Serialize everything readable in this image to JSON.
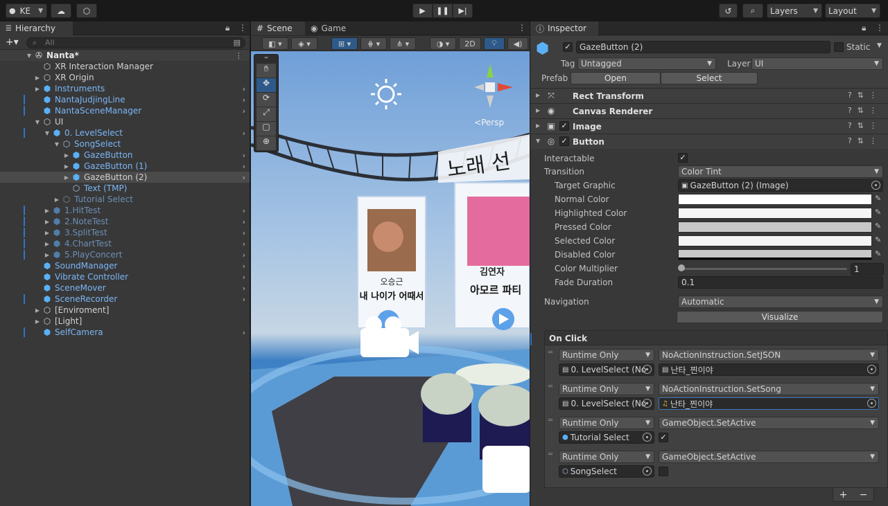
{
  "toolbar": {
    "account": "KE",
    "layers": "Layers",
    "layout": "Layout"
  },
  "hierarchy": {
    "tab": "Hierarchy",
    "search_placeholder": "All",
    "scene_name": "Nanta*",
    "items": [
      {
        "label": "XR Interaction Manager"
      },
      {
        "label": "XR Origin"
      },
      {
        "label": "Instruments"
      },
      {
        "label": "NantaJudjingLine"
      },
      {
        "label": "NantaSceneManager"
      },
      {
        "label": "UI"
      },
      {
        "label": "0. LevelSelect"
      },
      {
        "label": "SongSelect"
      },
      {
        "label": "GazeButton"
      },
      {
        "label": "GazeButton (1)"
      },
      {
        "label": "GazeButton (2)"
      },
      {
        "label": "Text (TMP)"
      },
      {
        "label": "Tutorial Select"
      },
      {
        "label": "1.HitTest"
      },
      {
        "label": "2.NoteTest"
      },
      {
        "label": "3.SplitTest"
      },
      {
        "label": "4.ChartTest"
      },
      {
        "label": "5.PlayConcert"
      },
      {
        "label": "SoundManager"
      },
      {
        "label": "Vibrate Controller"
      },
      {
        "label": "SceneMover"
      },
      {
        "label": "SceneRecorder"
      },
      {
        "label": "[Enviroment]"
      },
      {
        "label": "[Light]"
      },
      {
        "label": "SelfCamera"
      }
    ]
  },
  "scene": {
    "tab_scene": "Scene",
    "tab_game": "Game",
    "mode_2d": "2D",
    "persp": "Persp",
    "banner_text": "노래 선",
    "card1_artist": "오승근",
    "card1_title": "내 나이가 어때서",
    "card2_artist": "김연자",
    "card2_title": "아모르 파티"
  },
  "inspector": {
    "tab": "Inspector",
    "object_name": "GazeButton (2)",
    "static_label": "Static",
    "tag_label": "Tag",
    "tag_value": "Untagged",
    "layer_label": "Layer",
    "layer_value": "UI",
    "prefab_label": "Prefab",
    "prefab_open": "Open",
    "prefab_select": "Select",
    "components": [
      {
        "name": "Rect Transform"
      },
      {
        "name": "Canvas Renderer"
      },
      {
        "name": "Image"
      },
      {
        "name": "Button"
      }
    ],
    "button": {
      "interactable_label": "Interactable",
      "transition_label": "Transition",
      "transition_value": "Color Tint",
      "target_graphic_label": "Target Graphic",
      "target_graphic_value": "GazeButton (2) (Image)",
      "normal_color_label": "Normal Color",
      "highlighted_color_label": "Highlighted Color",
      "pressed_color_label": "Pressed Color",
      "selected_color_label": "Selected Color",
      "disabled_color_label": "Disabled Color",
      "color_multiplier_label": "Color Multiplier",
      "color_multiplier_value": "1",
      "fade_duration_label": "Fade Duration",
      "fade_duration_value": "0.1",
      "navigation_label": "Navigation",
      "navigation_value": "Automatic",
      "visualize": "Visualize"
    },
    "on_click": {
      "header": "On Click",
      "entries": [
        {
          "mode": "Runtime Only",
          "function": "NoActionInstruction.SetJSON",
          "target": "0. LevelSelect (No",
          "argument": "난타_찐이야"
        },
        {
          "mode": "Runtime Only",
          "function": "NoActionInstruction.SetSong",
          "target": "0. LevelSelect (No",
          "argument": "난타_찐이야"
        },
        {
          "mode": "Runtime Only",
          "function": "GameObject.SetActive",
          "target": "Tutorial Select",
          "argument": ""
        },
        {
          "mode": "Runtime Only",
          "function": "GameObject.SetActive",
          "target": "SongSelect",
          "argument": ""
        }
      ],
      "add": "+",
      "remove": "−"
    }
  }
}
